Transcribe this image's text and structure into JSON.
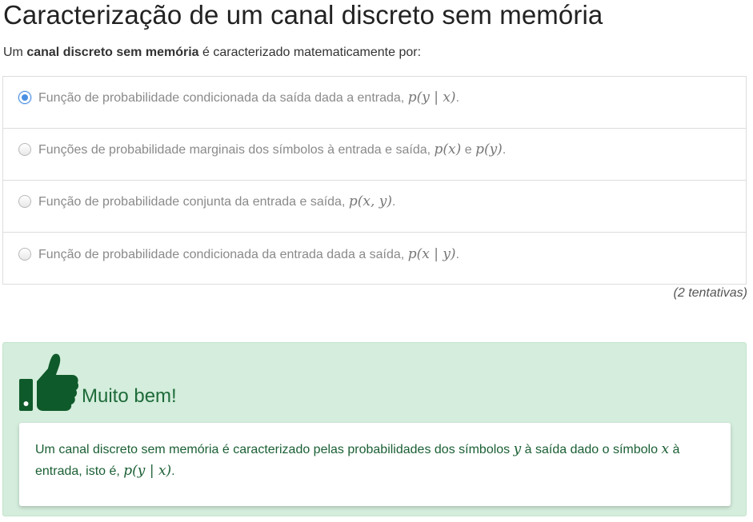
{
  "title": "Caracterização de um canal discreto sem memória",
  "question": {
    "prefix": "Um ",
    "bold": "canal discreto sem memória",
    "suffix": " é caracterizado matematicamente por:"
  },
  "options": [
    {
      "text": "Função de probabilidade condicionada da saída dada a entrada, ",
      "math": "p(y | x)",
      "tail": ".",
      "checked": true
    },
    {
      "text": "Funções de probabilidade marginais dos símbolos à entrada e saída, ",
      "math": "p(x)",
      "mid": " e ",
      "math2": "p(y)",
      "tail": ".",
      "checked": false
    },
    {
      "text": "Função de probabilidade conjunta da entrada e saída, ",
      "math": "p(x, y)",
      "tail": ".",
      "checked": false
    },
    {
      "text": "Função de probabilidade condicionada da entrada dada a saída, ",
      "math": "p(x | y)",
      "tail": ".",
      "checked": false
    }
  ],
  "attempts": "(2 tentativas)",
  "feedback": {
    "icon": "thumbs-up-icon",
    "title": "Muito bem!",
    "text1": "Um canal discreto sem memória é caracterizado pelas probabilidades dos símbolos ",
    "math_y": "y",
    "text2": " à saída dado o símbolo ",
    "math_x": "x",
    "text3": " à entrada, isto é, ",
    "math_pyx": "p(y | x)",
    "text4": "."
  },
  "colors": {
    "feedback_bg": "#d4eddc",
    "feedback_text": "#1a5f34",
    "thumb": "#0f5a2a",
    "radio_selected": "#4a90e2"
  }
}
